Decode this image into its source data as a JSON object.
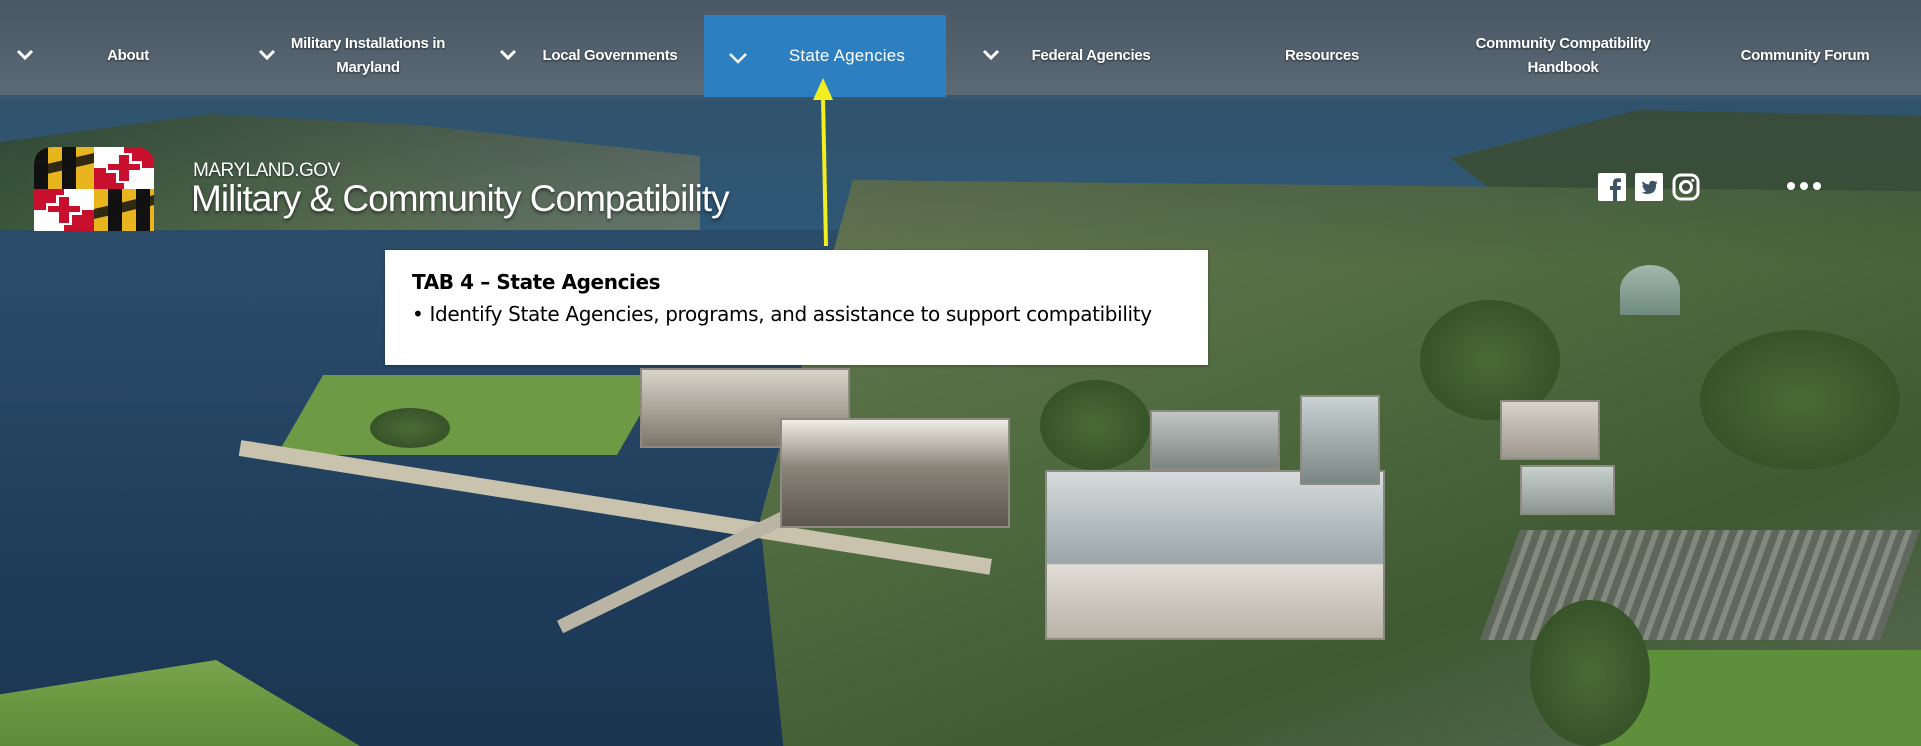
{
  "nav": {
    "items": [
      {
        "label": "About",
        "has_dropdown": true
      },
      {
        "label": "Military Installations in Maryland",
        "line1": "Military Installations in",
        "line2": "Maryland",
        "has_dropdown": true
      },
      {
        "label": "Local Governments",
        "has_dropdown": true
      },
      {
        "label": "State Agencies",
        "has_dropdown": true,
        "active": true
      },
      {
        "label": "Federal Agencies",
        "has_dropdown": true
      },
      {
        "label": "Resources",
        "has_dropdown": false
      },
      {
        "label": "Community Compatibility Handbook",
        "line1": "Community Compatibility",
        "line2": "Handbook",
        "has_dropdown": false
      },
      {
        "label": "Community Forum",
        "has_dropdown": false
      }
    ],
    "dropdown_icon": "chevron-down-icon",
    "active_color": "#2c7fc1"
  },
  "brand": {
    "site_label": "MARYLAND.GOV",
    "title": "Military & Community Compatibility",
    "logo_icon": "maryland-flag-logo"
  },
  "social": {
    "icons": [
      "facebook-icon",
      "twitter-icon",
      "instagram-icon"
    ],
    "more_icon": "more-dots-icon"
  },
  "annotation": {
    "title": "TAB 4 – State Agencies",
    "bullet": "• Identify State Agencies, programs, and assistance to support compatibility",
    "arrow_color": "#f2ee1f"
  }
}
